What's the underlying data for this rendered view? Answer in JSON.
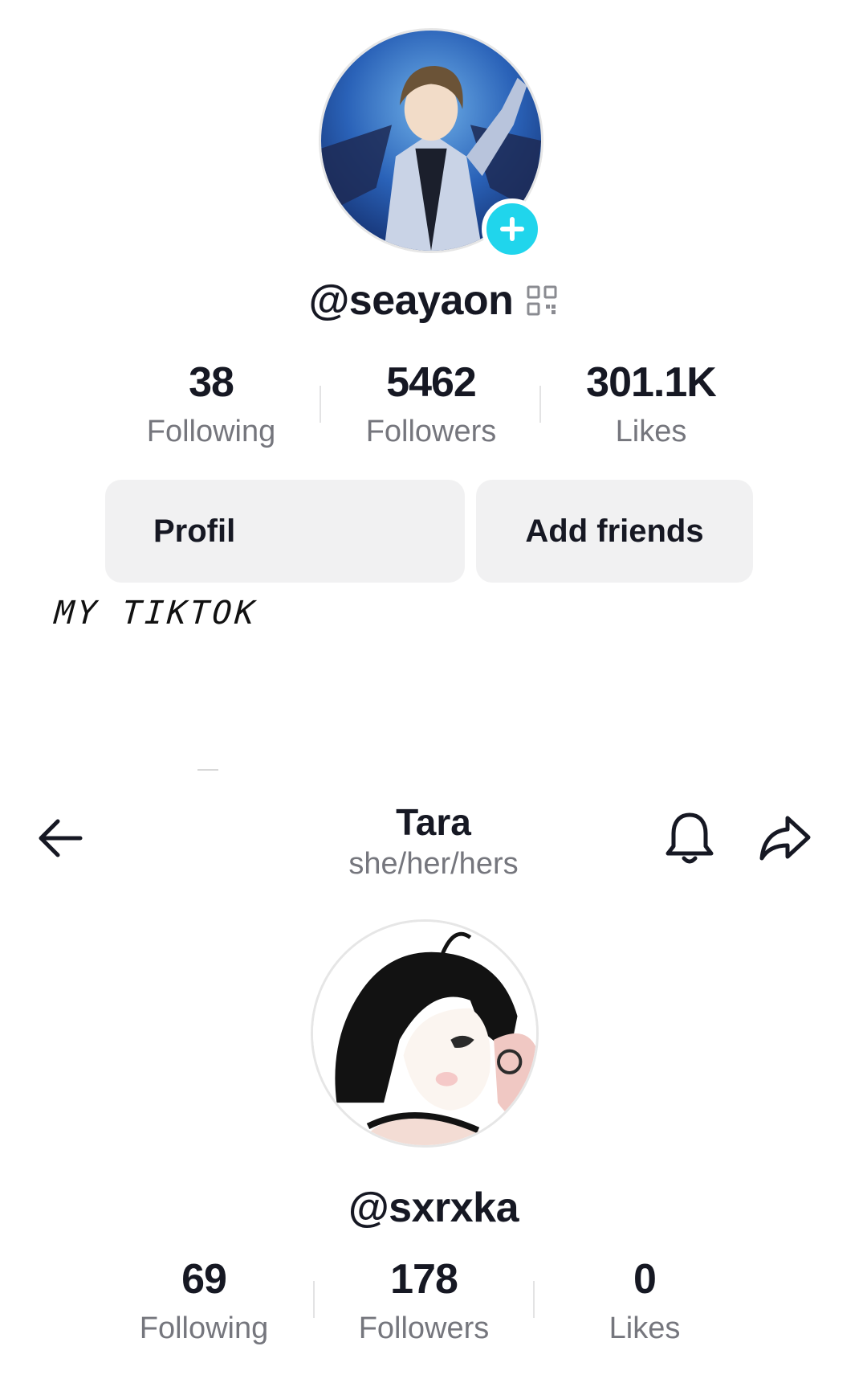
{
  "profile_self": {
    "username": "@seayaon",
    "stats": [
      {
        "value": "38",
        "label": "Following"
      },
      {
        "value": "5462",
        "label": "Followers"
      },
      {
        "value": "301.1K",
        "label": "Likes"
      }
    ],
    "buttons": {
      "profile": "Profil",
      "add_friends": "Add friends"
    }
  },
  "caption": "MY TIKTOK",
  "profile_other": {
    "header": {
      "name": "Tara",
      "pronouns": "she/her/hers"
    },
    "username": "@sxrxka",
    "stats": [
      {
        "value": "69",
        "label": "Following"
      },
      {
        "value": "178",
        "label": "Followers"
      },
      {
        "value": "0",
        "label": "Likes"
      }
    ]
  },
  "icons": {
    "add_badge": "plus-icon",
    "qr": "qr-code-icon",
    "back": "arrow-left-icon",
    "notifications": "bell-icon",
    "share": "share-arrow-icon"
  },
  "colors": {
    "accent": "#20d5ec",
    "text": "#161823",
    "muted": "#75767d",
    "button_bg": "#f1f1f2"
  }
}
